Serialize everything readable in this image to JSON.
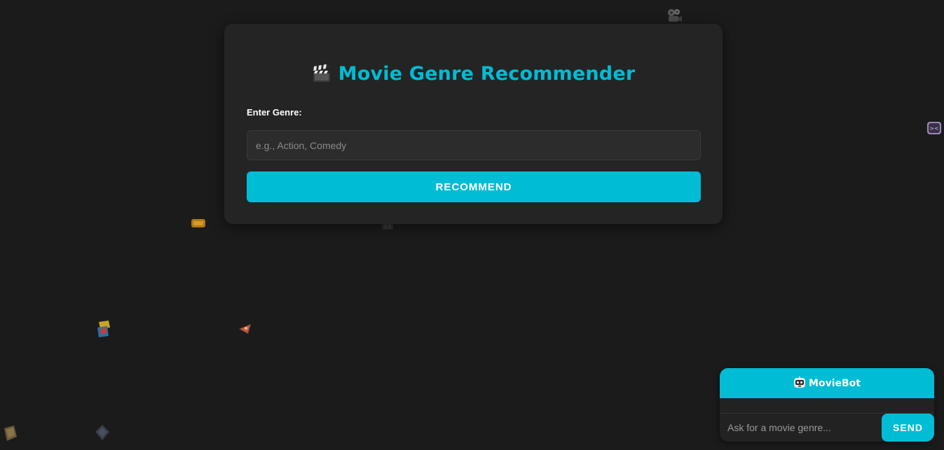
{
  "app": {
    "title": "Movie Genre Recommender",
    "title_icon": "clapper-board-icon"
  },
  "form": {
    "genre_label": "Enter Genre:",
    "genre_value": "",
    "genre_placeholder": "e.g., Action, Comedy",
    "recommend_label": "RECOMMEND"
  },
  "chatbot": {
    "title": "MovieBot",
    "title_icon": "robot-face-icon",
    "input_value": "",
    "input_placeholder": "Ask for a movie genre...",
    "send_label": "SEND"
  },
  "decorations": [
    "film-projector-icon",
    "game-controller-icon",
    "ticket-icon",
    "film-frame-icon",
    "popcorn-icon",
    "pizza-slice-icon",
    "film-box-icon",
    "film-reel-icon"
  ],
  "colors": {
    "accent": "#00bcd4",
    "background": "#1b1b1b",
    "card": "#242424"
  }
}
